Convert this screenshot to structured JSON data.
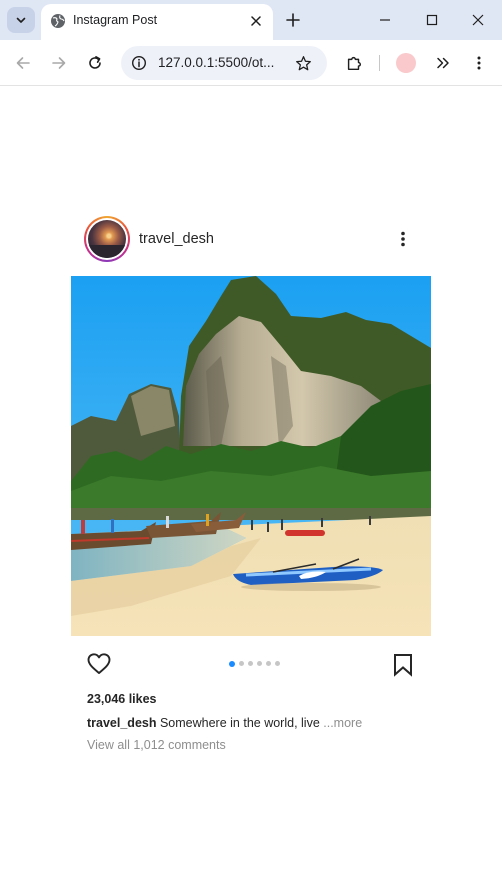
{
  "browser": {
    "tab_title": "Instagram Post",
    "url": "127.0.0.1:5500/ot...",
    "profile_color": "#f9c9cb"
  },
  "post": {
    "username": "travel_desh",
    "likes_text": "23,046 likes",
    "caption_user": "travel_desh",
    "caption_text": "Somewhere in the world, live",
    "caption_more": "...more",
    "view_comments": "View all 1,012 comments",
    "carousel": {
      "total": 6,
      "active_index": 0
    },
    "accent_color": "#1a8cff",
    "icons": [
      "more-vertical-icon",
      "heart-outline-icon",
      "bookmark-outline-icon"
    ]
  }
}
